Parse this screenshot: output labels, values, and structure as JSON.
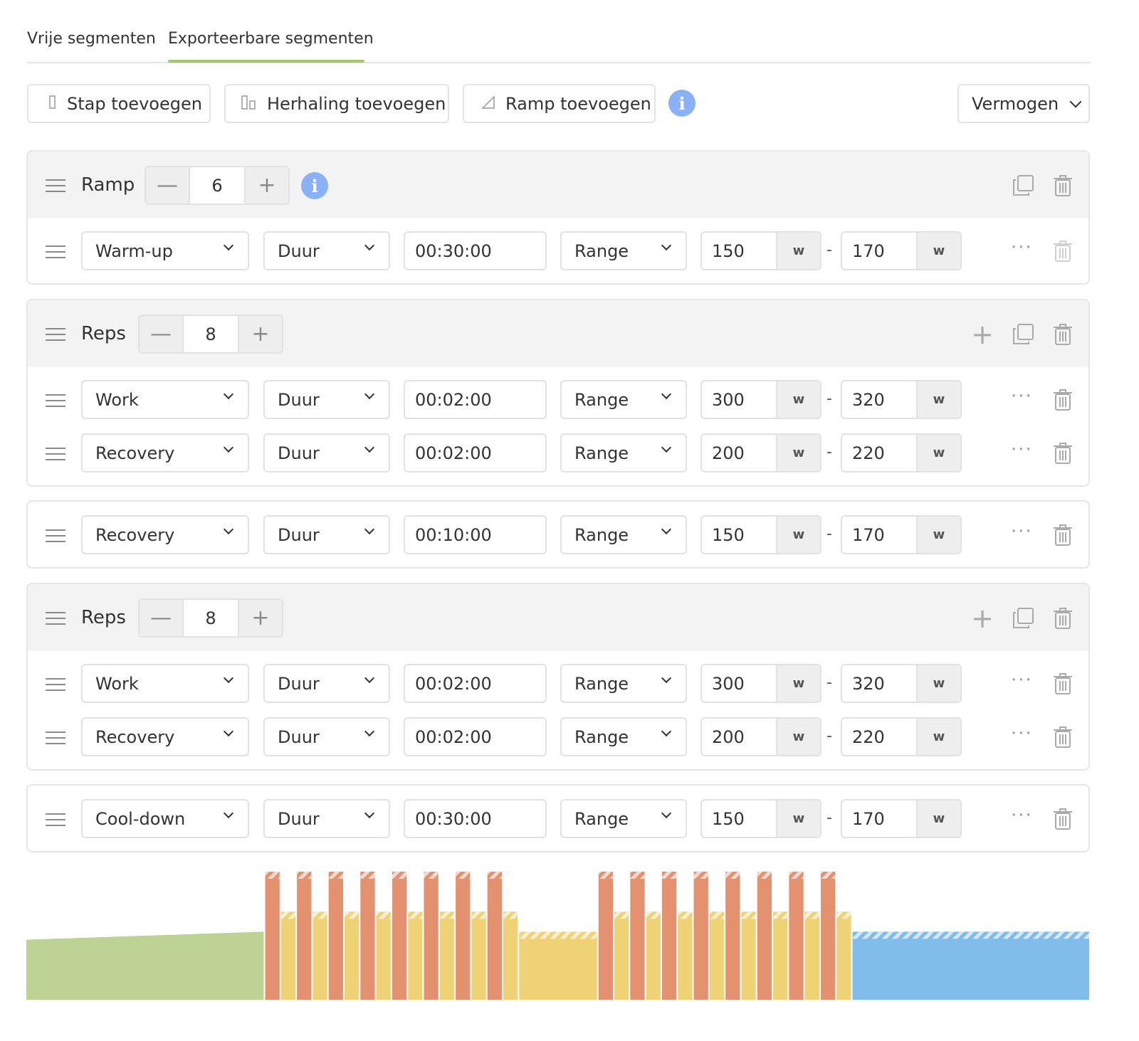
{
  "tabs": [
    {
      "label": "Vrije segmenten",
      "active": false
    },
    {
      "label": "Exporteerbare segmenten",
      "active": true
    }
  ],
  "toolbar": {
    "add_step": "Stap toevoegen",
    "add_repeat": "Herhaling toevoegen",
    "add_ramp": "Ramp toevoegen",
    "info_glyph": "i",
    "metric": "Vermogen"
  },
  "groups": {
    "ramp": {
      "label": "Ramp",
      "count": "6",
      "info_glyph": "i",
      "rows": [
        {
          "type": "Warm-up",
          "mode": "Duur",
          "duration": "00:30:00",
          "target": "Range",
          "low": "150",
          "high": "170",
          "unit": "w"
        }
      ]
    },
    "reps1": {
      "label": "Reps",
      "count": "8",
      "rows": [
        {
          "type": "Work",
          "mode": "Duur",
          "duration": "00:02:00",
          "target": "Range",
          "low": "300",
          "high": "320",
          "unit": "w"
        },
        {
          "type": "Recovery",
          "mode": "Duur",
          "duration": "00:02:00",
          "target": "Range",
          "low": "200",
          "high": "220",
          "unit": "w"
        }
      ]
    },
    "single1": {
      "rows": [
        {
          "type": "Recovery",
          "mode": "Duur",
          "duration": "00:10:00",
          "target": "Range",
          "low": "150",
          "high": "170",
          "unit": "w"
        }
      ]
    },
    "reps2": {
      "label": "Reps",
      "count": "8",
      "rows": [
        {
          "type": "Work",
          "mode": "Duur",
          "duration": "00:02:00",
          "target": "Range",
          "low": "300",
          "high": "320",
          "unit": "w"
        },
        {
          "type": "Recovery",
          "mode": "Duur",
          "duration": "00:02:00",
          "target": "Range",
          "low": "200",
          "high": "220",
          "unit": "w"
        }
      ]
    },
    "single2": {
      "rows": [
        {
          "type": "Cool-down",
          "mode": "Duur",
          "duration": "00:30:00",
          "target": "Range",
          "low": "150",
          "high": "170",
          "unit": "w"
        }
      ]
    }
  },
  "icons": {
    "drag": "drag-handle-icon",
    "copy": "copy-icon",
    "trash": "trash-icon",
    "plus": "plus-icon",
    "minus": "minus-icon",
    "more": "more-dots-icon",
    "info": "info-icon"
  },
  "colors": {
    "accent_tab": "#a4c96a",
    "info": "#8ab0f5",
    "warmup": "#bcd393",
    "work": "#e4916f",
    "recovery": "#efd276",
    "cooldown": "#7fbce9"
  },
  "chart_data": {
    "type": "area",
    "segments": [
      {
        "name": "Warm-up",
        "kind": "ramp",
        "duration_min": 30,
        "start_w": 150,
        "end_w": 170
      },
      {
        "name": "Reps 8x",
        "kind": "repeat",
        "count": 8,
        "work": {
          "duration_min": 2,
          "low_w": 300,
          "high_w": 320
        },
        "recovery": {
          "duration_min": 2,
          "low_w": 200,
          "high_w": 220
        }
      },
      {
        "name": "Recovery",
        "kind": "steady",
        "duration_min": 10,
        "low_w": 150,
        "high_w": 170
      },
      {
        "name": "Reps 8x",
        "kind": "repeat",
        "count": 8,
        "work": {
          "duration_min": 2,
          "low_w": 300,
          "high_w": 320
        },
        "recovery": {
          "duration_min": 2,
          "low_w": 200,
          "high_w": 220
        }
      },
      {
        "name": "Cool-down",
        "kind": "steady",
        "duration_min": 30,
        "low_w": 150,
        "high_w": 170
      }
    ],
    "ylim": [
      0,
      320
    ]
  }
}
